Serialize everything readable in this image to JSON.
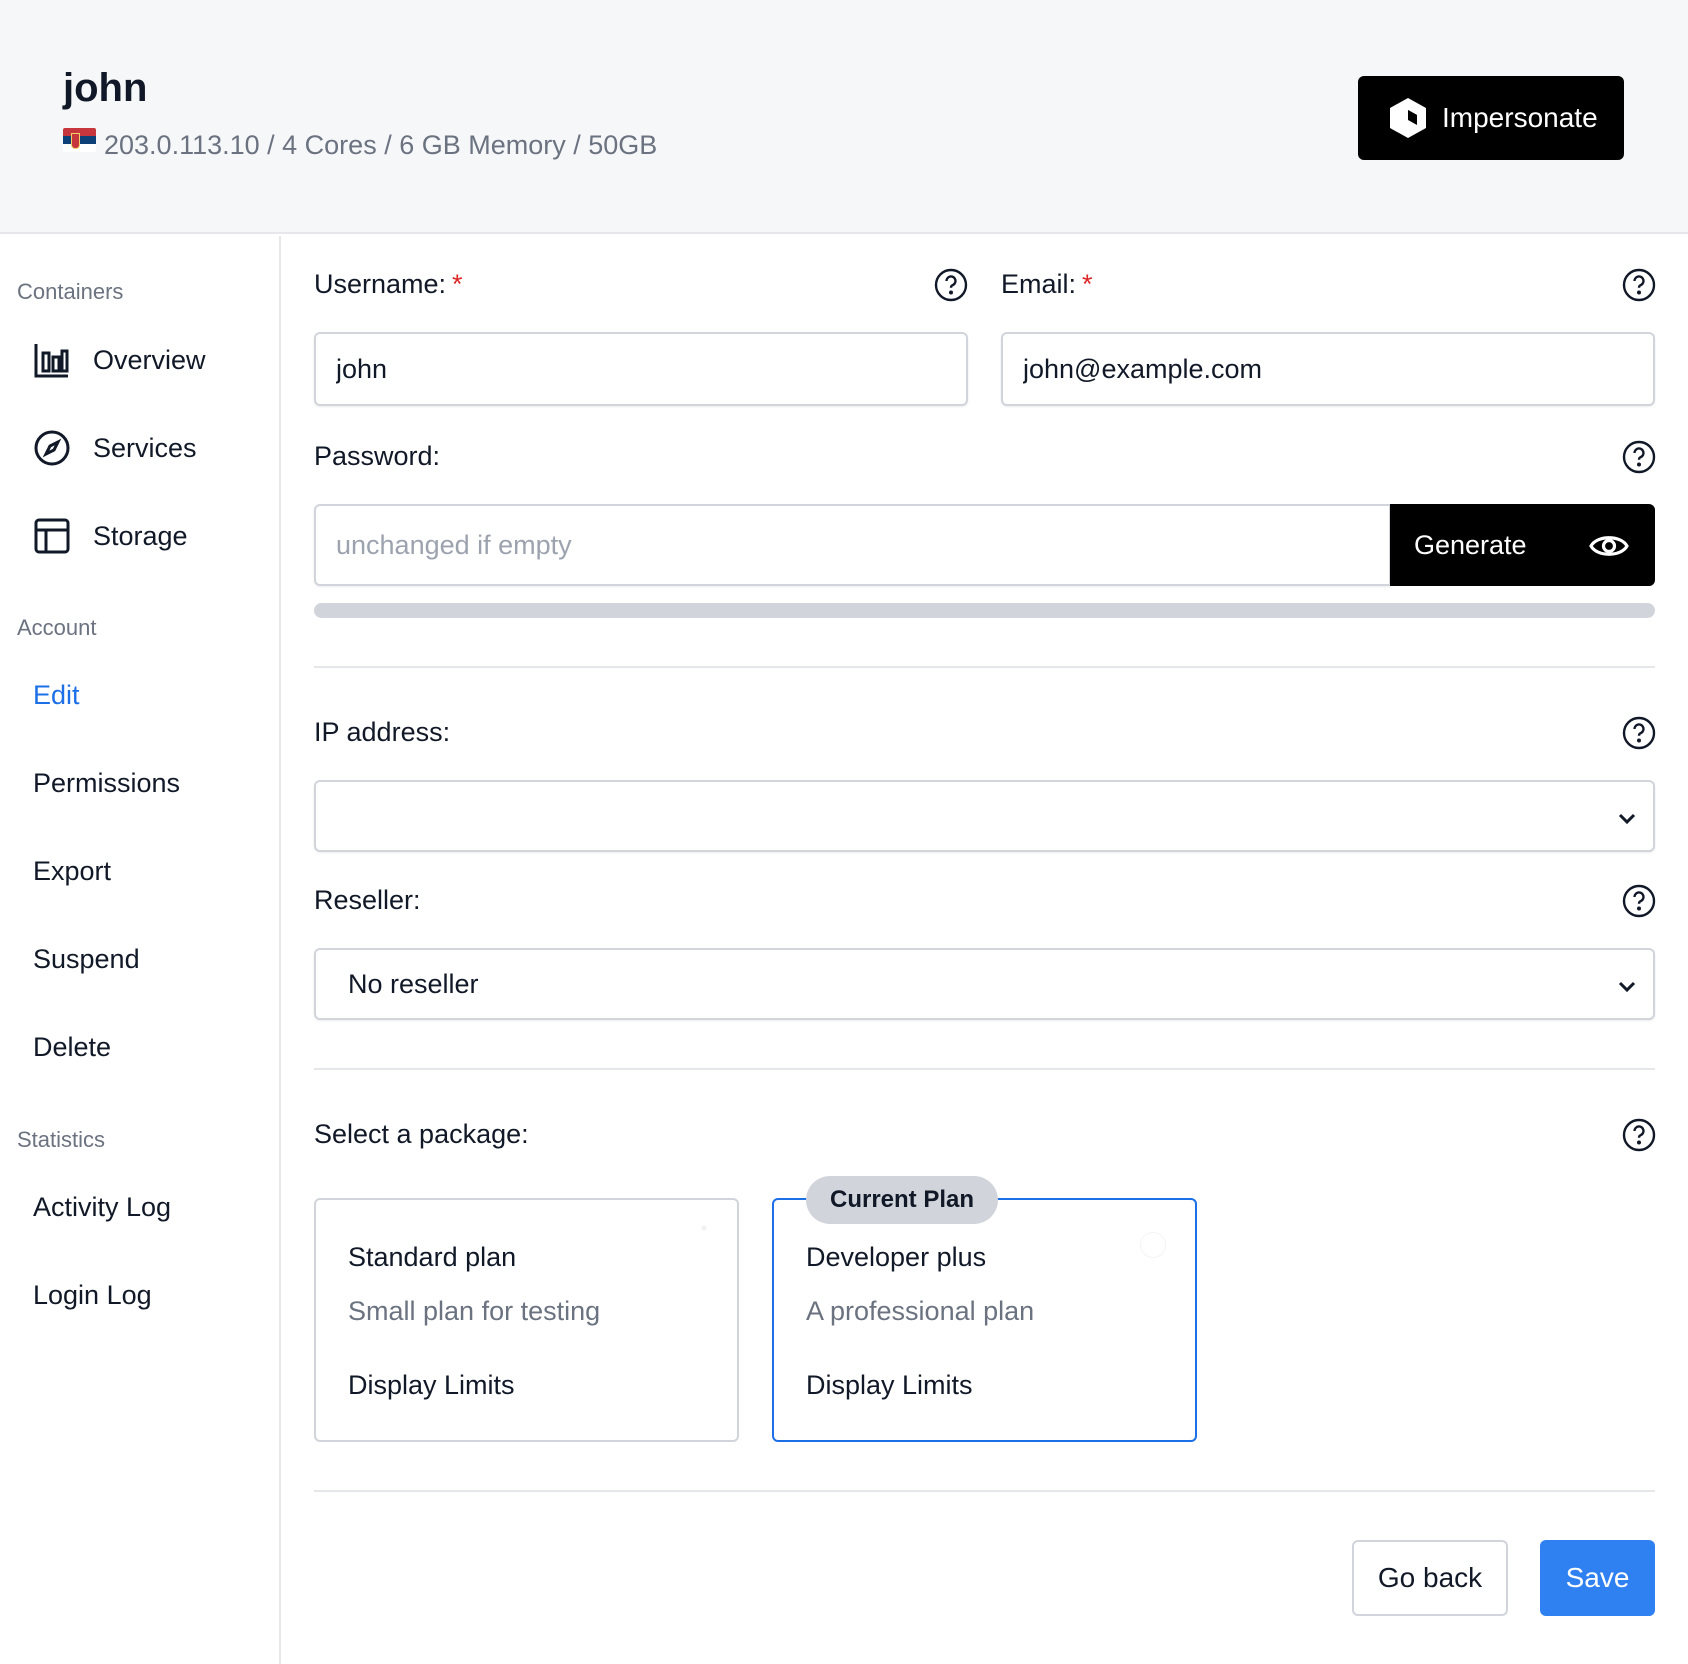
{
  "header": {
    "user_name": "john",
    "flag_icon": "serbia-flag-icon",
    "meta": "203.0.113.10 / 4 Cores / 6 GB Memory / 50GB",
    "impersonate_label": "Impersonate"
  },
  "sidebar": {
    "containers_title": "Containers",
    "containers": [
      {
        "label": "Overview",
        "icon": "bar-chart-icon"
      },
      {
        "label": "Services",
        "icon": "compass-icon"
      },
      {
        "label": "Storage",
        "icon": "table-icon"
      }
    ],
    "account_title": "Account",
    "account": [
      {
        "label": "Edit",
        "active": true
      },
      {
        "label": "Permissions"
      },
      {
        "label": "Export"
      },
      {
        "label": "Suspend"
      },
      {
        "label": "Delete"
      }
    ],
    "statistics_title": "Statistics",
    "statistics": [
      {
        "label": "Activity Log"
      },
      {
        "label": "Login Log"
      }
    ]
  },
  "form": {
    "username_label": "Username:",
    "username_value": "john",
    "email_label": "Email:",
    "email_value": "john@example.com",
    "required_mark": "*",
    "password_label": "Password:",
    "password_placeholder": "unchanged if empty",
    "generate_label": "Generate",
    "ip_label": "IP address:",
    "ip_value": "",
    "reseller_label": "Reseller:",
    "reseller_value": "No reseller",
    "package_label": "Select a package:",
    "packages": [
      {
        "name": "Standard plan",
        "description": "Small plan for testing",
        "limits": "Display Limits",
        "current": false
      },
      {
        "name": "Developer plus",
        "description": "A professional plan",
        "limits": "Display Limits",
        "current": true
      }
    ],
    "current_plan_badge": "Current Plan"
  },
  "actions": {
    "back_label": "Go back",
    "save_label": "Save"
  },
  "colors": {
    "accent": "#2f80f0",
    "active_link": "#1d6fe8",
    "required": "#dc2626"
  }
}
